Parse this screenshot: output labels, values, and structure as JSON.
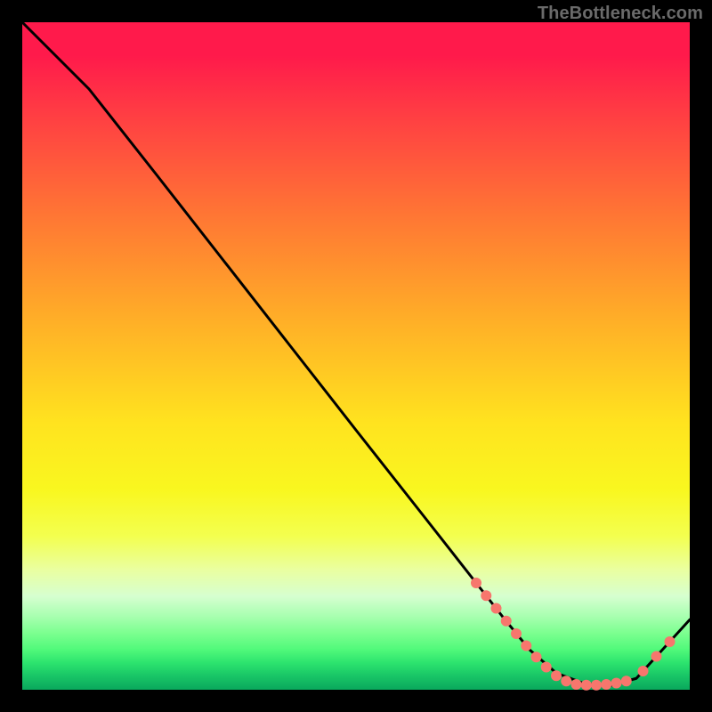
{
  "watermark": "TheBottleneck.com",
  "chart_data": {
    "type": "line",
    "title": "",
    "xlabel": "",
    "ylabel": "",
    "xlim": [
      0,
      100
    ],
    "ylim": [
      0,
      100
    ],
    "grid": false,
    "legend": false,
    "series": [
      {
        "name": "curve",
        "x": [
          0,
          6,
          10,
          20,
          30,
          40,
          50,
          60,
          68,
          72,
          76,
          80,
          84,
          88,
          92,
          100
        ],
        "y": [
          100,
          94,
          90,
          77.3,
          64.5,
          51.7,
          38.9,
          26.2,
          16,
          10.9,
          6,
          2.5,
          1,
          0.6,
          1.7,
          10.5
        ]
      }
    ],
    "markers": [
      {
        "name": "dot",
        "x": 68.0,
        "y": 16.0
      },
      {
        "name": "dot",
        "x": 69.5,
        "y": 14.1
      },
      {
        "name": "dot",
        "x": 71.0,
        "y": 12.2
      },
      {
        "name": "dot",
        "x": 72.5,
        "y": 10.3
      },
      {
        "name": "dot",
        "x": 74.0,
        "y": 8.4
      },
      {
        "name": "dot",
        "x": 75.5,
        "y": 6.6
      },
      {
        "name": "dot",
        "x": 77.0,
        "y": 4.9
      },
      {
        "name": "dot",
        "x": 78.5,
        "y": 3.4
      },
      {
        "name": "dot",
        "x": 80.0,
        "y": 2.1
      },
      {
        "name": "dot",
        "x": 81.5,
        "y": 1.3
      },
      {
        "name": "dot",
        "x": 83.0,
        "y": 0.8
      },
      {
        "name": "dot",
        "x": 84.5,
        "y": 0.7
      },
      {
        "name": "dot",
        "x": 86.0,
        "y": 0.7
      },
      {
        "name": "dot",
        "x": 87.5,
        "y": 0.8
      },
      {
        "name": "dot",
        "x": 89.0,
        "y": 1.0
      },
      {
        "name": "dot",
        "x": 90.5,
        "y": 1.3
      },
      {
        "name": "dot",
        "x": 93.0,
        "y": 2.8
      },
      {
        "name": "dot",
        "x": 95.0,
        "y": 5.0
      },
      {
        "name": "dot",
        "x": 97.0,
        "y": 7.2
      }
    ],
    "colors": {
      "line": "#000000",
      "marker": "#f7766d",
      "gradient_top": "#ff1a4b",
      "gradient_mid": "#ffe31f",
      "gradient_bottom": "#0aa85c"
    }
  }
}
